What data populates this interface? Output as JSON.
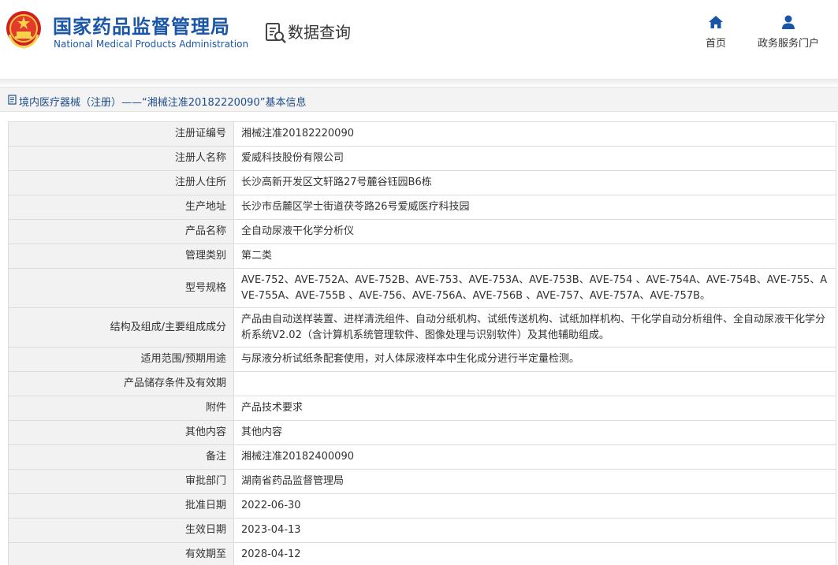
{
  "header": {
    "org_name_cn": "国家药品监督管理局",
    "org_name_en": "National Medical Products Administration",
    "section_title": "数据查询",
    "nav": [
      {
        "label": "首页",
        "icon": "home-icon"
      },
      {
        "label": "政务服务门户",
        "icon": "user-icon"
      }
    ]
  },
  "breadcrumb": {
    "text": "境内医疗器械（注册）——“湘械注准20182220090”基本信息"
  },
  "colors": {
    "brand_blue": "#1a56a8",
    "key_column_bg": "#f2f2f2",
    "border": "#dcdcdc"
  },
  "record": {
    "rows": [
      {
        "label": "注册证编号",
        "value": "湘械注准20182220090"
      },
      {
        "label": "注册人名称",
        "value": "爱威科技股份有限公司"
      },
      {
        "label": "注册人住所",
        "value": "长沙高新开发区文轩路27号麓谷钰园B6栋"
      },
      {
        "label": "生产地址",
        "value": "长沙市岳麓区学士街道茯苓路26号爱威医疗科技园"
      },
      {
        "label": "产品名称",
        "value": "全自动尿液干化学分析仪"
      },
      {
        "label": "管理类别",
        "value": "第二类"
      },
      {
        "label": "型号规格",
        "value": "AVE-752、AVE-752A、AVE-752B、AVE-753、AVE-753A、AVE-753B、AVE-754 、AVE-754A、AVE-754B、AVE-755、AVE-755A、AVE-755B 、AVE-756、AVE-756A、AVE-756B 、AVE-757、AVE-757A、AVE-757B。"
      },
      {
        "label": "结构及组成/主要组成成分",
        "value": "产品由自动送样装置、进样清洗组件、自动分纸机构、试纸传送机构、试纸加样机构、干化学自动分析组件、全自动尿液干化学分析系统V2.02（含计算机系统管理软件、图像处理与识别软件）及其他辅助组成。"
      },
      {
        "label": "适用范围/预期用途",
        "value": "与尿液分析试纸条配套使用，对人体尿液样本中生化成分进行半定量检测。"
      },
      {
        "label": "产品储存条件及有效期",
        "value": ""
      },
      {
        "label": "附件",
        "value": "产品技术要求"
      },
      {
        "label": "其他内容",
        "value": "其他内容"
      },
      {
        "label": "备注",
        "value": "湘械注准20182400090"
      },
      {
        "label": "审批部门",
        "value": "湖南省药品监督管理局"
      },
      {
        "label": "批准日期",
        "value": "2022-06-30"
      },
      {
        "label": "生效日期",
        "value": "2023-04-13"
      },
      {
        "label": "有效期至",
        "value": "2028-04-12"
      }
    ]
  }
}
